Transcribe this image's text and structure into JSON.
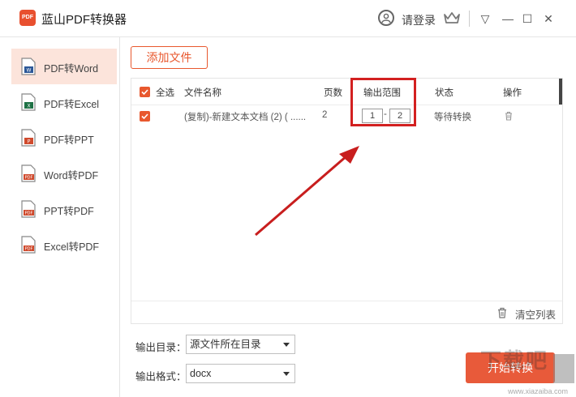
{
  "app": {
    "title": "蓝山PDF转换器",
    "logo_text": "PDF",
    "login_label": "请登录"
  },
  "window_controls": {
    "menu": "▽",
    "minimize": "—",
    "maximize": "☐",
    "close": "✕"
  },
  "sidebar": {
    "items": [
      {
        "label": "PDF转Word",
        "icon": "word-file-icon",
        "badge": "W",
        "color": "#2b5797",
        "active": true
      },
      {
        "label": "PDF转Excel",
        "icon": "excel-file-icon",
        "badge": "X",
        "color": "#1e7145",
        "active": false
      },
      {
        "label": "PDF转PPT",
        "icon": "ppt-file-icon",
        "badge": "P",
        "color": "#d04a2d",
        "active": false
      },
      {
        "label": "Word转PDF",
        "icon": "pdf-file-icon",
        "badge": "PDF",
        "color": "#d04a2d",
        "active": false
      },
      {
        "label": "PPT转PDF",
        "icon": "pdf-file-icon",
        "badge": "PDF",
        "color": "#d04a2d",
        "active": false
      },
      {
        "label": "Excel转PDF",
        "icon": "pdf-file-icon",
        "badge": "PDF",
        "color": "#d04a2d",
        "active": false
      }
    ]
  },
  "toolbar": {
    "add_file_label": "添加文件"
  },
  "table": {
    "headers": {
      "select_all": "全选",
      "file_name": "文件名称",
      "pages": "页数",
      "output_range": "输出范围",
      "status": "状态",
      "actions": "操作"
    },
    "rows": [
      {
        "file_name": "(复制)-新建文本文档 (2) ( ......",
        "pages": "2",
        "range_from": "1",
        "range_sep": "-",
        "range_to": "2",
        "status": "等待转换",
        "checked": true
      }
    ],
    "clear_label": "清空列表"
  },
  "settings": {
    "output_dir_label": "输出目录：",
    "output_dir_value": "源文件所在目录",
    "output_format_label": "输出格式：",
    "output_format_value": "docx"
  },
  "start_button_label": "开始转换",
  "watermark": {
    "text": "下载吧",
    "url": "www.xiazaiba.com"
  },
  "colors": {
    "accent": "#e8582e",
    "highlight": "#d32020",
    "active_bg": "#fce4db"
  }
}
